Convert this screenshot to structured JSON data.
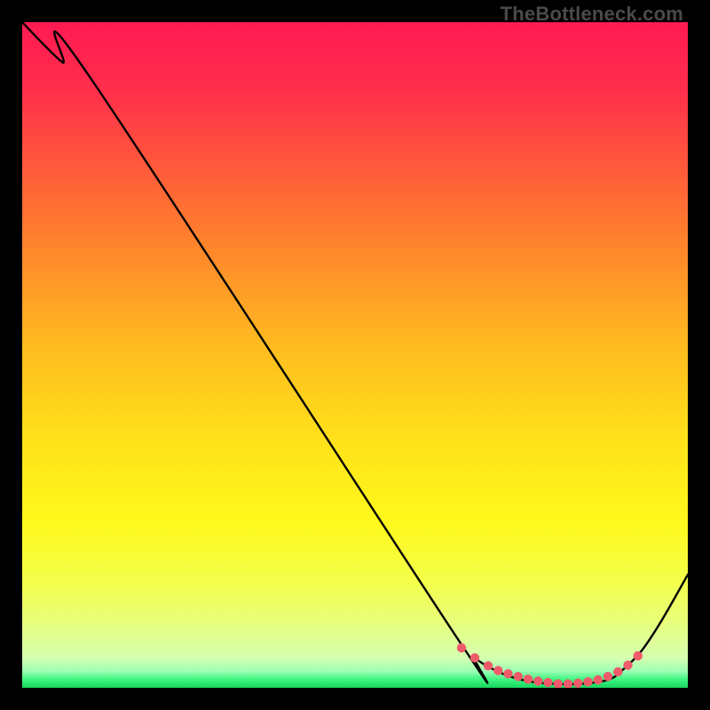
{
  "watermark": "TheBottleneck.com",
  "gradient_stops": [
    {
      "offset": 0.0,
      "color": "#ff1a52"
    },
    {
      "offset": 0.1,
      "color": "#ff2e4c"
    },
    {
      "offset": 0.22,
      "color": "#ff5a3a"
    },
    {
      "offset": 0.35,
      "color": "#ff8a2a"
    },
    {
      "offset": 0.5,
      "color": "#ffbf1f"
    },
    {
      "offset": 0.63,
      "color": "#ffe21a"
    },
    {
      "offset": 0.75,
      "color": "#fff81c"
    },
    {
      "offset": 0.84,
      "color": "#f4ff4a"
    },
    {
      "offset": 0.9,
      "color": "#e7ff7a"
    },
    {
      "offset": 0.955,
      "color": "#d6ffb0"
    },
    {
      "offset": 0.975,
      "color": "#9cffb4"
    },
    {
      "offset": 0.988,
      "color": "#3cf57e"
    },
    {
      "offset": 1.0,
      "color": "#18d45e"
    }
  ],
  "chart_data": {
    "type": "line",
    "title": "",
    "xlabel": "",
    "ylabel": "",
    "xlim": [
      0,
      100
    ],
    "ylim": [
      0,
      100
    ],
    "series": [
      {
        "name": "bottleneck-curve",
        "x": [
          0,
          6,
          10,
          65,
          68,
          72,
          76,
          80,
          84,
          88,
          90,
          93,
          96,
          100
        ],
        "y": [
          100,
          94,
          92,
          8,
          4.5,
          2.2,
          1.0,
          0.6,
          0.6,
          1.2,
          2.5,
          5.5,
          10,
          17
        ]
      }
    ],
    "markers": {
      "name": "highlight-dots",
      "x": [
        66,
        68,
        70,
        71.5,
        73,
        74.5,
        76,
        77.5,
        79,
        80.5,
        82,
        83.5,
        85,
        86.5,
        88,
        89.5,
        91,
        92.5
      ],
      "y": [
        6.0,
        4.5,
        3.3,
        2.6,
        2.1,
        1.7,
        1.3,
        1.0,
        0.8,
        0.6,
        0.6,
        0.7,
        0.9,
        1.2,
        1.7,
        2.4,
        3.4,
        4.8
      ]
    }
  }
}
